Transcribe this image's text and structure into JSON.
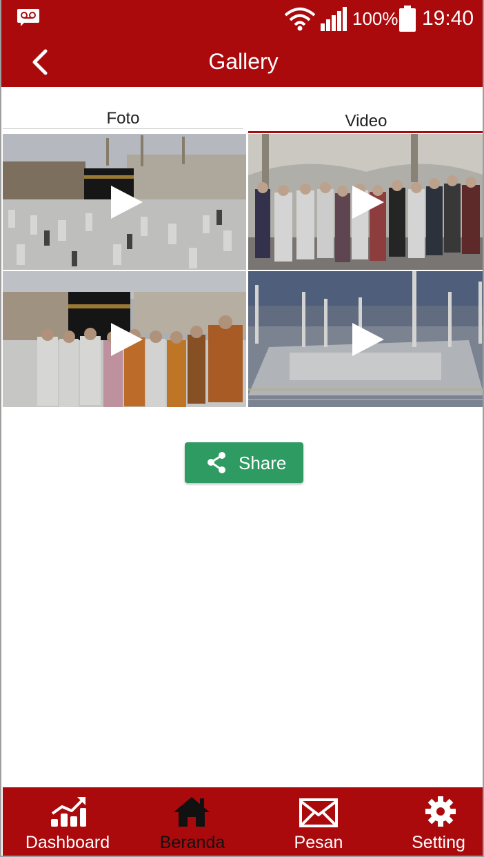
{
  "status_bar": {
    "battery_percent": "100%",
    "time": "19:40",
    "icons": [
      "voicemail-icon",
      "wifi-icon",
      "signal-icon",
      "battery-icon"
    ]
  },
  "app_bar": {
    "title": "Gallery",
    "back_icon": "chevron-left-icon"
  },
  "tabs": [
    {
      "label": "Foto",
      "selected": false
    },
    {
      "label": "Video",
      "selected": true
    }
  ],
  "videos": [
    {
      "thumbnail": "kaaba-crowd",
      "icon": "play-icon"
    },
    {
      "thumbnail": "pilgrims-group-umbrellas",
      "icon": "play-icon"
    },
    {
      "thumbnail": "pilgrims-group-kaaba",
      "icon": "play-icon"
    },
    {
      "thumbnail": "mosque-night-aerial",
      "icon": "play-icon"
    }
  ],
  "share": {
    "label": "Share",
    "icon": "share-icon"
  },
  "bottom_nav": {
    "items": [
      {
        "label": "Dashboard",
        "icon": "dashboard-chart-icon"
      },
      {
        "label": "Beranda",
        "icon": "home-icon",
        "active": true
      },
      {
        "label": "Pesan",
        "icon": "mail-icon"
      },
      {
        "label": "Setting",
        "icon": "gear-icon"
      }
    ]
  },
  "colors": {
    "brand": "#ab0a0d",
    "share_green": "#2e9b63",
    "tab_indicator": "#ab0a0d"
  }
}
